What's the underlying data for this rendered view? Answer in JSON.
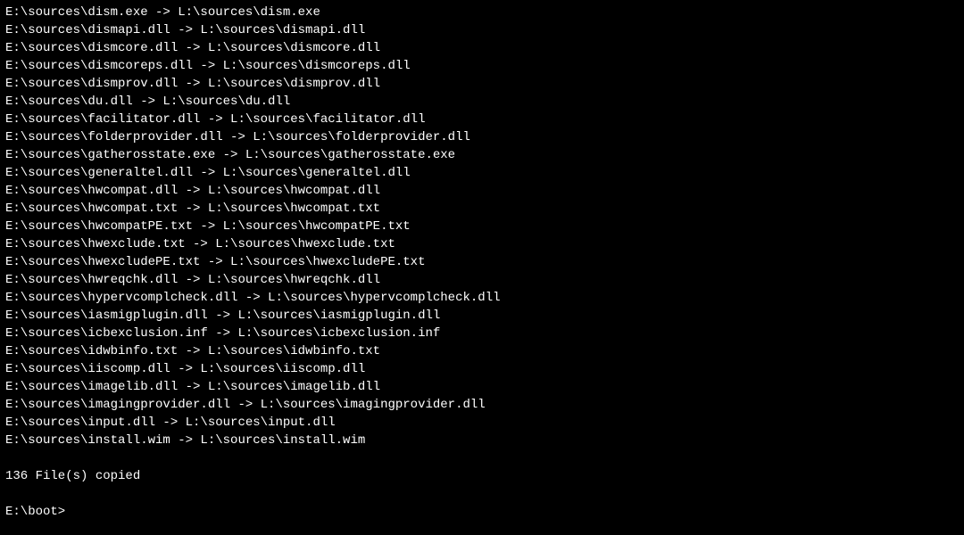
{
  "output_lines": [
    "E:\\sources\\dism.exe -> L:\\sources\\dism.exe",
    "E:\\sources\\dismapi.dll -> L:\\sources\\dismapi.dll",
    "E:\\sources\\dismcore.dll -> L:\\sources\\dismcore.dll",
    "E:\\sources\\dismcoreps.dll -> L:\\sources\\dismcoreps.dll",
    "E:\\sources\\dismprov.dll -> L:\\sources\\dismprov.dll",
    "E:\\sources\\du.dll -> L:\\sources\\du.dll",
    "E:\\sources\\facilitator.dll -> L:\\sources\\facilitator.dll",
    "E:\\sources\\folderprovider.dll -> L:\\sources\\folderprovider.dll",
    "E:\\sources\\gatherosstate.exe -> L:\\sources\\gatherosstate.exe",
    "E:\\sources\\generaltel.dll -> L:\\sources\\generaltel.dll",
    "E:\\sources\\hwcompat.dll -> L:\\sources\\hwcompat.dll",
    "E:\\sources\\hwcompat.txt -> L:\\sources\\hwcompat.txt",
    "E:\\sources\\hwcompatPE.txt -> L:\\sources\\hwcompatPE.txt",
    "E:\\sources\\hwexclude.txt -> L:\\sources\\hwexclude.txt",
    "E:\\sources\\hwexcludePE.txt -> L:\\sources\\hwexcludePE.txt",
    "E:\\sources\\hwreqchk.dll -> L:\\sources\\hwreqchk.dll",
    "E:\\sources\\hypervcomplcheck.dll -> L:\\sources\\hypervcomplcheck.dll",
    "E:\\sources\\iasmigplugin.dll -> L:\\sources\\iasmigplugin.dll",
    "E:\\sources\\icbexclusion.inf -> L:\\sources\\icbexclusion.inf",
    "E:\\sources\\idwbinfo.txt -> L:\\sources\\idwbinfo.txt",
    "E:\\sources\\iiscomp.dll -> L:\\sources\\iiscomp.dll",
    "E:\\sources\\imagelib.dll -> L:\\sources\\imagelib.dll",
    "E:\\sources\\imagingprovider.dll -> L:\\sources\\imagingprovider.dll",
    "E:\\sources\\input.dll -> L:\\sources\\input.dll",
    "E:\\sources\\install.wim -> L:\\sources\\install.wim"
  ],
  "summary_line": "136 File(s) copied",
  "prompt": "E:\\boot>"
}
